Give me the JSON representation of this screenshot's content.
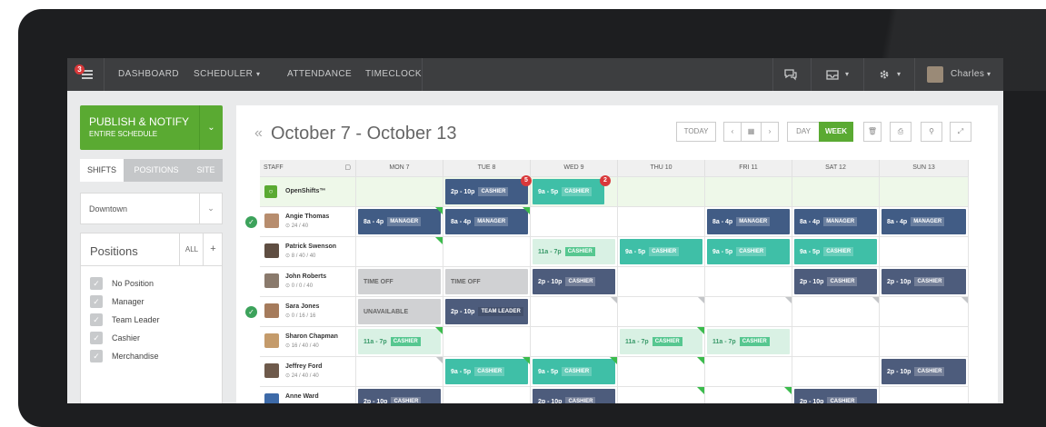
{
  "nav": {
    "notif_count": "3",
    "items": [
      "DASHBOARD",
      "SCHEDULER",
      "ATTENDANCE",
      "TIMECLOCK"
    ],
    "scheduler_caret": "▾",
    "user": "Charles"
  },
  "sidebar": {
    "publish_title": "PUBLISH & NOTIFY",
    "publish_sub": "ENTIRE SCHEDULE",
    "tabs": [
      "SHIFTS",
      "POSITIONS",
      "SITE"
    ],
    "location": "Downtown",
    "positions_title": "Positions",
    "all_label": "ALL",
    "add_label": "+",
    "positions": [
      "No Position",
      "Manager",
      "Team Leader",
      "Cashier",
      "Merchandise"
    ]
  },
  "header": {
    "prev": "«",
    "title": "October 7 - October 13",
    "today": "TODAY",
    "day": "DAY",
    "week": "WEEK"
  },
  "table": {
    "staff_header": "STAFF",
    "days": [
      "MON 7",
      "TUE 8",
      "WED 9",
      "THU 10",
      "FRI 11",
      "SAT 12",
      "SUN 13"
    ],
    "open_label": "OpenShifts™",
    "open_shifts": [
      {
        "time": "2p - 10p",
        "tag": "CASHIER",
        "count": "5"
      },
      {
        "time": "9a - 5p",
        "tag": "CASHIER",
        "count": "2"
      }
    ],
    "staff": [
      {
        "name": "Angie Thomas",
        "hours": "⊙ 24 / 40"
      },
      {
        "name": "Patrick Swenson",
        "hours": "⊙ 8 / 40 / 40"
      },
      {
        "name": "John Roberts",
        "hours": "⊙ 0 / 0 / 40"
      },
      {
        "name": "Sara Jones",
        "hours": "⊙ 0 / 16 / 16"
      },
      {
        "name": "Sharon Chapman",
        "hours": "⊙ 16 / 40 / 40"
      },
      {
        "name": "Jeffrey Ford",
        "hours": "⊙ 24 / 40 / 40"
      },
      {
        "name": "Anne Ward",
        "hours": ""
      }
    ],
    "labels": {
      "t8a4p": "8a - 4p",
      "t11a7p": "11a - 7p",
      "t9a5p": "9a - 5p",
      "t2p10p": "2p - 10p",
      "manager": "MANAGER",
      "cashier": "CASHIER",
      "team_leader": "TEAM LEADER",
      "time_off": "TIME OFF",
      "unavailable": "UNAVAILABLE"
    }
  },
  "colors": {
    "topbar": "#3d3e40",
    "publish": "#5aaa32",
    "week_active": "#5aaa32",
    "manager_shift": "#415c85",
    "cashier_shift": "#3fbfa7",
    "slate_shift": "#4d5c7c"
  },
  "icons": [
    "menu-icon",
    "chat-icon",
    "inbox-icon",
    "gear-icon",
    "calendar-icon",
    "trash-icon",
    "print-icon",
    "wrench-icon",
    "expand-icon",
    "check-icon"
  ]
}
